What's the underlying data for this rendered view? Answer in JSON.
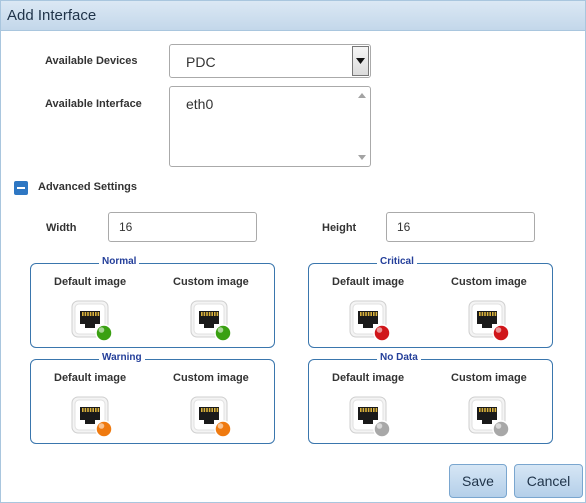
{
  "dialog": {
    "title": "Add Interface"
  },
  "devices": {
    "label": "Available Devices",
    "selected": "PDC"
  },
  "interface": {
    "label": "Available Interface",
    "items": [
      "eth0"
    ]
  },
  "advanced": {
    "label": "Advanced Settings",
    "width_label": "Width",
    "width_value": "16",
    "height_label": "Height",
    "height_value": "16"
  },
  "groups": [
    {
      "legend": "Normal",
      "default_label": "Default image",
      "custom_label": "Custom image",
      "status_color": "#3aa012"
    },
    {
      "legend": "Critical",
      "default_label": "Default image",
      "custom_label": "Custom image",
      "status_color": "#d0161a"
    },
    {
      "legend": "Warning",
      "default_label": "Default image",
      "custom_label": "Custom image",
      "status_color": "#ef7a10"
    },
    {
      "legend": "No Data",
      "default_label": "Default image",
      "custom_label": "Custom image",
      "status_color": "#a8a8a8"
    }
  ],
  "buttons": {
    "save": "Save",
    "cancel": "Cancel"
  },
  "colors": {
    "accent": "#2e77c3",
    "group_border": "#3a76ad",
    "legend_text": "#243f9a"
  }
}
